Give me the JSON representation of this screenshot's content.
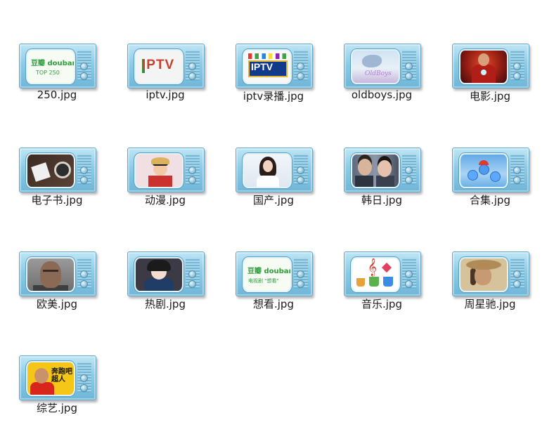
{
  "files": [
    {
      "name": "250.jpg",
      "screen": {
        "line1": "豆瓣 douban",
        "line2": "TOP 250"
      }
    },
    {
      "name": "iptv.jpg",
      "screen": {
        "line1": "IPTV"
      }
    },
    {
      "name": "iptv录播.jpg",
      "screen": {
        "line1": "IPTV"
      }
    },
    {
      "name": "oldboys.jpg",
      "screen": {
        "line1": "OldBoys"
      }
    },
    {
      "name": "电影.jpg"
    },
    {
      "name": "电子书.jpg"
    },
    {
      "name": "动漫.jpg"
    },
    {
      "name": "国产.jpg"
    },
    {
      "name": "韩日.jpg"
    },
    {
      "name": "合集.jpg"
    },
    {
      "name": "欧美.jpg"
    },
    {
      "name": "热剧.jpg"
    },
    {
      "name": "想看.jpg",
      "screen": {
        "line1": "豆瓣 douban",
        "line2": "电视剧 \"想看\""
      }
    },
    {
      "name": "音乐.jpg"
    },
    {
      "name": "周星驰.jpg"
    },
    {
      "name": "综艺.jpg",
      "screen": {
        "line1": "奔跑吧超人"
      }
    }
  ]
}
